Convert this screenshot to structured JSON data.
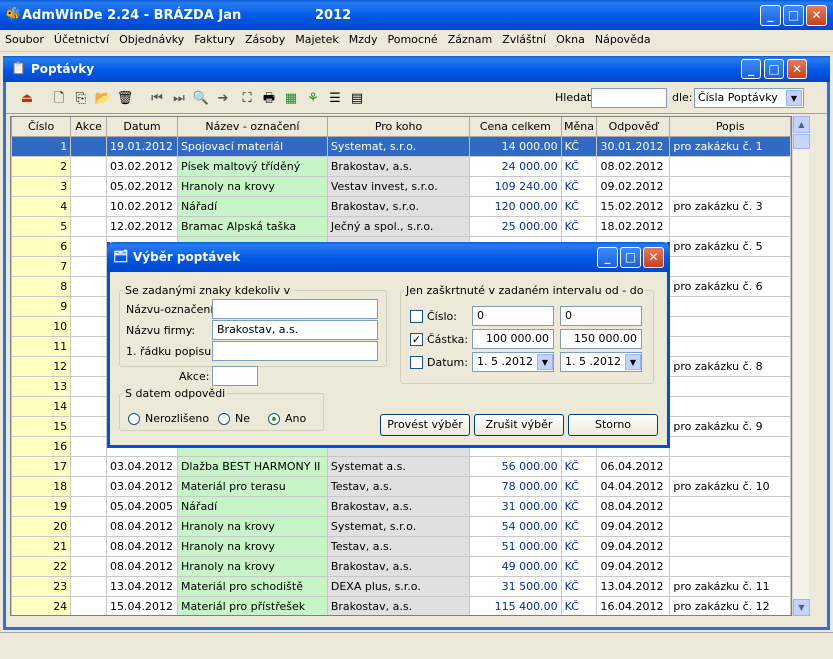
{
  "app": {
    "title": "AdmWinDe 2.24 - BRÁZDA Jan",
    "year": "2012",
    "menu": [
      "Soubor",
      "Účetnictví",
      "Objednávky",
      "Faktury",
      "Zásoby",
      "Majetek",
      "Mzdy",
      "Pomocné",
      "Záznam",
      "Zvláštní",
      "Okna",
      "Nápověda"
    ]
  },
  "window": {
    "title": "Poptávky",
    "search_label": "Hledat:",
    "search_value": "",
    "by_label": "dle:",
    "by_value": "Čísla Poptávky"
  },
  "table": {
    "columns": [
      "Číslo",
      "Akce",
      "Datum",
      "Název - označení",
      "Pro koho",
      "Cena celkem",
      "Měna",
      "Odpověď",
      "Popis"
    ],
    "rows": [
      [
        "1",
        "",
        "19.01.2012",
        "Spojovací materiál",
        "Systemat, s.r.o.",
        "14 000.00",
        "KČ",
        "30.01.2012",
        "pro zakázku č. 1"
      ],
      [
        "2",
        "",
        "03.02.2012",
        "Písek maltový tříděný",
        "Brakostav, a.s.",
        "24 000.00",
        "KČ",
        "08.02.2012",
        ""
      ],
      [
        "3",
        "",
        "05.02.2012",
        "Hranoly na krovy",
        "Vestav invest, s.r.o.",
        "109 240.00",
        "KČ",
        "09.02.2012",
        ""
      ],
      [
        "4",
        "",
        "10.02.2012",
        "Nářadí",
        "Brakostav, s.r.o.",
        "120 000.00",
        "KČ",
        "15.02.2012",
        "pro zakázku č. 3"
      ],
      [
        "5",
        "",
        "12.02.2012",
        "Bramac Alpská taška",
        "Ječný a spol., s.r.o.",
        "25 000.00",
        "KČ",
        "18.02.2012",
        ""
      ],
      [
        "6",
        "",
        "",
        "",
        "",
        "",
        "",
        "",
        "pro zakázku č. 5"
      ],
      [
        "7",
        "",
        "",
        "",
        "",
        "",
        "",
        "",
        ""
      ],
      [
        "8",
        "",
        "",
        "",
        "",
        "",
        "",
        "",
        "pro zakázku č. 6"
      ],
      [
        "9",
        "",
        "",
        "",
        "",
        "",
        "",
        "",
        ""
      ],
      [
        "10",
        "",
        "",
        "",
        "",
        "",
        "",
        "",
        ""
      ],
      [
        "11",
        "",
        "",
        "",
        "",
        "",
        "",
        "",
        ""
      ],
      [
        "12",
        "",
        "",
        "",
        "",
        "",
        "",
        "",
        "pro zakázku č. 8"
      ],
      [
        "13",
        "",
        "",
        "",
        "",
        "",
        "",
        "",
        ""
      ],
      [
        "14",
        "",
        "",
        "",
        "",
        "",
        "",
        "",
        ""
      ],
      [
        "15",
        "",
        "",
        "",
        "",
        "",
        "",
        "",
        "pro zakázku č. 9"
      ],
      [
        "16",
        "",
        "",
        "",
        "",
        "",
        "",
        "",
        ""
      ],
      [
        "17",
        "",
        "03.04.2012",
        "Dlažba BEST HARMONY II",
        "Systemat a.s.",
        "56 000.00",
        "KČ",
        "06.04.2012",
        ""
      ],
      [
        "18",
        "",
        "03.04.2012",
        "Materiál pro terasu",
        "Testav, a.s.",
        "78 000.00",
        "KČ",
        "04.04.2012",
        "pro zakázku č. 10"
      ],
      [
        "19",
        "",
        "05.04.2005",
        "Nářadí",
        "Brakostav, a.s.",
        "31 000.00",
        "KČ",
        "08.04.2012",
        ""
      ],
      [
        "20",
        "",
        "08.04.2012",
        "Hranoly na krovy",
        "Systemat, s.r.o.",
        "54 000.00",
        "KČ",
        "09.04.2012",
        ""
      ],
      [
        "21",
        "",
        "08.04.2012",
        "Hranoly na krovy",
        "Testav, a.s.",
        "51 000.00",
        "KČ",
        "09.04.2012",
        ""
      ],
      [
        "22",
        "",
        "08.04.2012",
        "Hranoly na krovy",
        "Brakostav, a.s.",
        "49 000.00",
        "KČ",
        "09.04.2012",
        ""
      ],
      [
        "23",
        "",
        "13.04.2012",
        "Materiál pro schodiště",
        "DEXA plus, s.r.o.",
        "31 500.00",
        "KČ",
        "13.04.2012",
        "pro zakázku č. 11"
      ],
      [
        "24",
        "",
        "15.04.2012",
        "Materiál pro přístřešek",
        "Brakostav, a.s.",
        "115 400.00",
        "KČ",
        "16.04.2012",
        "pro zakázku č. 12"
      ]
    ]
  },
  "dialog": {
    "title": "Výběr poptávek",
    "left_group": "Se zadanými znaky kdekoliv v",
    "name_label": "Názvu-označení:",
    "name_value": "",
    "firm_label": "Názvu firmy:",
    "firm_value": "Brakostav, a.s.",
    "desc_label": "1. řádku popisu:",
    "desc_value": "",
    "action_label": "Akce:",
    "action_value": "",
    "date_group": "S datem odpovědi",
    "radio_undecided": "Nerozlišeno",
    "radio_no": "Ne",
    "radio_yes": "Ano",
    "right_group": "Jen zaškrtnuté v zadaném intervalu od - do",
    "number_label": "Číslo:",
    "number_from": "0",
    "number_to": "0",
    "amount_label": "Částka:",
    "amount_from": "100 000.00",
    "amount_to": "150 000.00",
    "date_label": "Datum:",
    "date_from": "1. 5 .2012",
    "date_to": "1. 5 .2012",
    "btn_apply": "Provést výběr",
    "btn_cancel_filter": "Zrušit výběr",
    "btn_storno": "Storno"
  }
}
